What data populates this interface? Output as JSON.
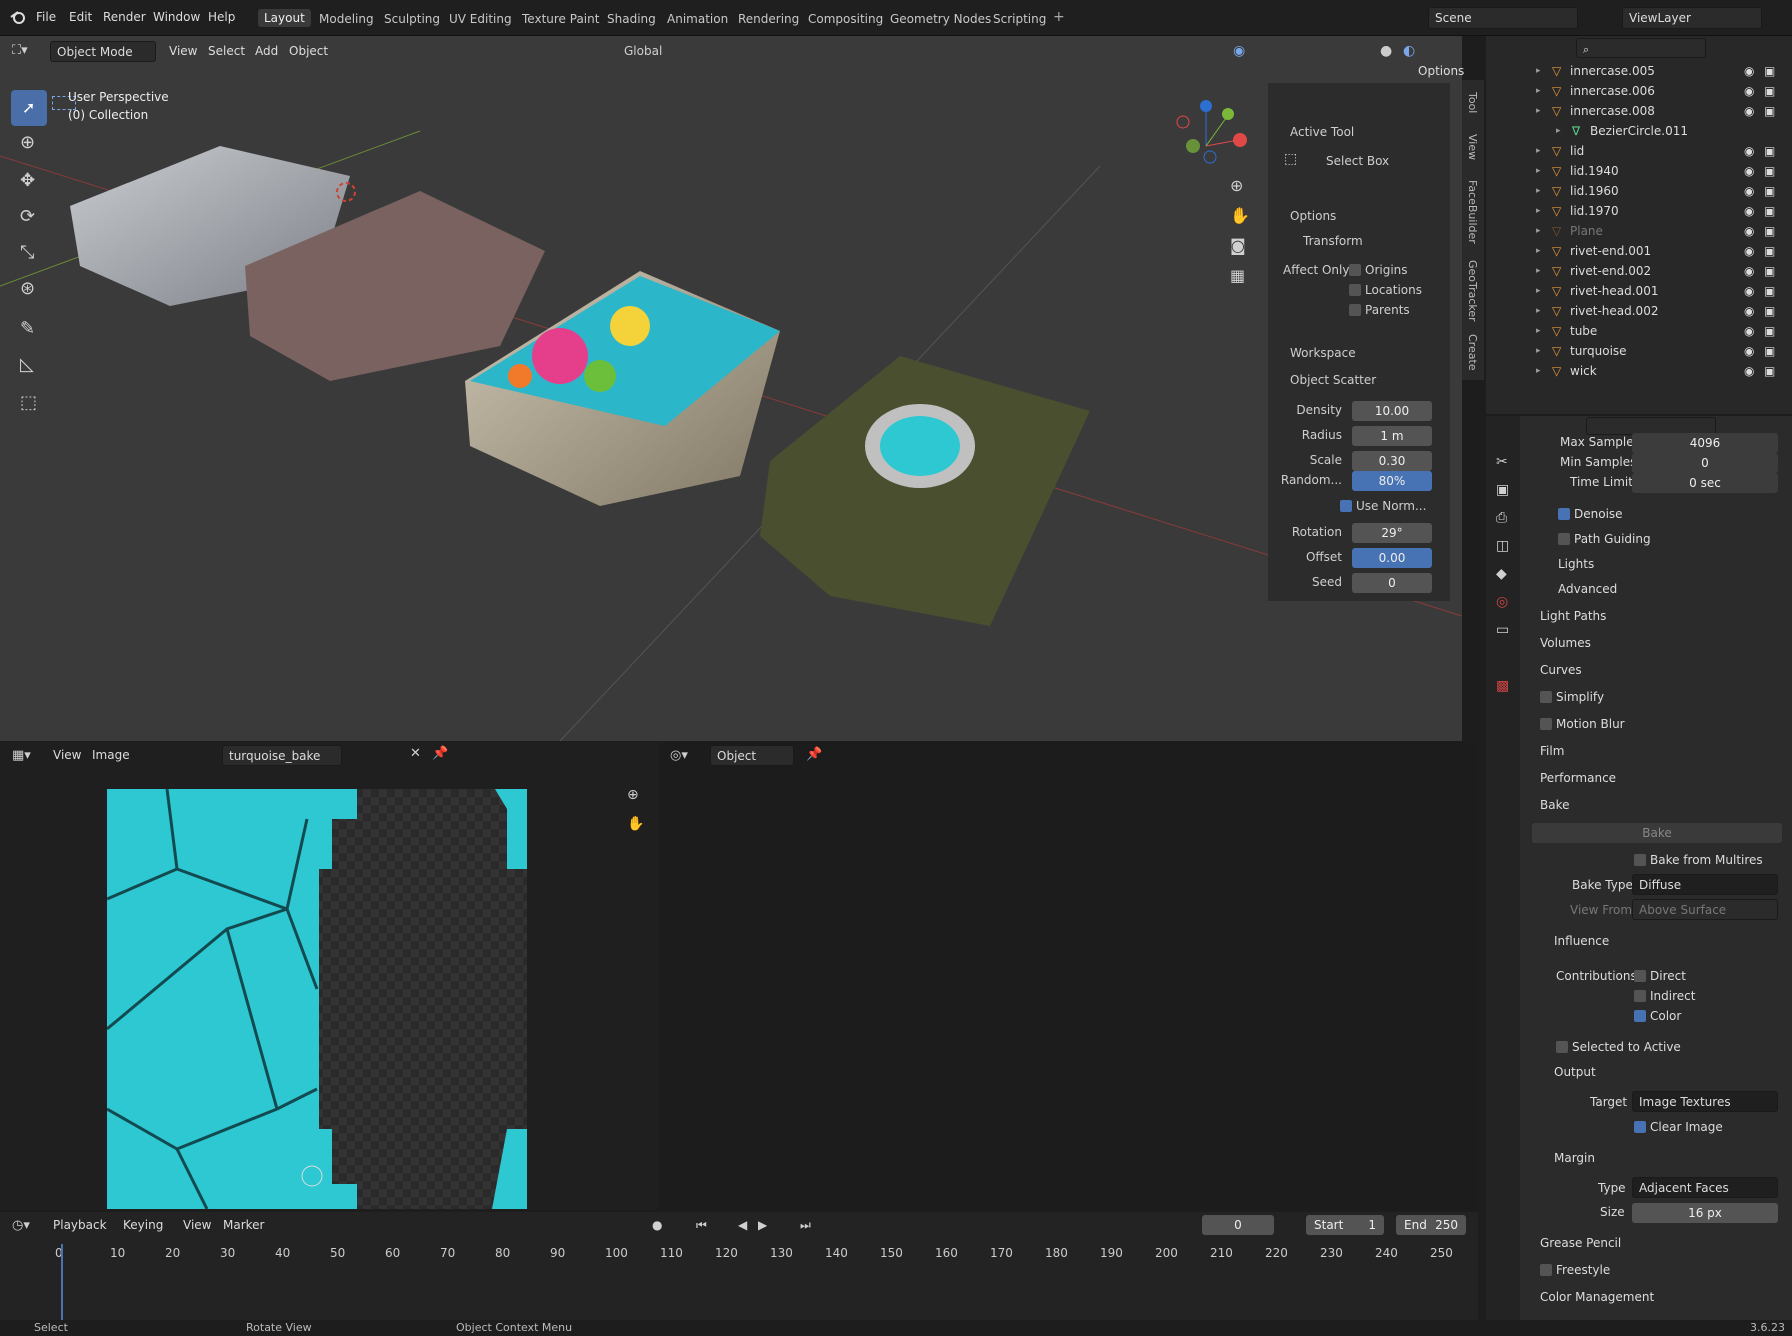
{
  "topbar": {
    "menus": [
      "File",
      "Edit",
      "Render",
      "Window",
      "Help"
    ],
    "workspaces": [
      "Layout",
      "Modeling",
      "Sculpting",
      "UV Editing",
      "Texture Paint",
      "Shading",
      "Animation",
      "Rendering",
      "Compositing",
      "Geometry Nodes",
      "Scripting"
    ],
    "active_workspace": "Layout",
    "scene": "Scene",
    "view_layer": "ViewLayer"
  },
  "viewport": {
    "mode": "Object Mode",
    "menus": [
      "View",
      "Select",
      "Add",
      "Object"
    ],
    "orientation": "Global",
    "options_label": "Options",
    "perspective": "User Perspective",
    "collection": "(0) Collection"
  },
  "npanel": {
    "active_tool_header": "Active Tool",
    "tool_name": "Select Box",
    "options_header": "Options",
    "transform_header": "Transform",
    "affect_only_label": "Affect Only",
    "affect_items": [
      "Origins",
      "Locations",
      "Parents"
    ],
    "workspace_header": "Workspace",
    "scatter_header": "Object Scatter",
    "scatter": [
      {
        "label": "Density",
        "value": "10.00"
      },
      {
        "label": "Radius",
        "value": "1 m"
      },
      {
        "label": "Scale",
        "value": "0.30"
      },
      {
        "label": "Random...",
        "value": "80%"
      }
    ],
    "use_normal": "Use Norm...",
    "scatter2": [
      {
        "label": "Rotation",
        "value": "29°"
      },
      {
        "label": "Offset",
        "value": "0.00"
      },
      {
        "label": "Seed",
        "value": "0"
      }
    ],
    "tabs": [
      "Tool",
      "View",
      "FaceBuilder",
      "GeoTracker",
      "Create"
    ]
  },
  "outliner": {
    "items": [
      {
        "name": "innercase.005",
        "dim": false
      },
      {
        "name": "innercase.006",
        "dim": false
      },
      {
        "name": "innercase.008",
        "dim": false
      },
      {
        "name": "BezierCircle.011",
        "dim": false,
        "child": true
      },
      {
        "name": "lid",
        "dim": false
      },
      {
        "name": "lid.1940",
        "dim": false
      },
      {
        "name": "lid.1960",
        "dim": false
      },
      {
        "name": "lid.1970",
        "dim": false
      },
      {
        "name": "Plane",
        "dim": true
      },
      {
        "name": "rivet-end.001",
        "dim": false
      },
      {
        "name": "rivet-end.002",
        "dim": false
      },
      {
        "name": "rivet-head.001",
        "dim": false
      },
      {
        "name": "rivet-head.002",
        "dim": false
      },
      {
        "name": "tube",
        "dim": false
      },
      {
        "name": "turquoise",
        "dim": false
      },
      {
        "name": "wick",
        "dim": false
      }
    ]
  },
  "properties": {
    "max_samples_label": "Max Samples",
    "max_samples": "4096",
    "min_samples_label": "Min Samples",
    "min_samples": "0",
    "time_limit_label": "Time Limit",
    "time_limit": "0 sec",
    "sub": [
      "Denoise",
      "Path Guiding",
      "Lights",
      "Advanced"
    ],
    "sections": [
      "Light Paths",
      "Volumes",
      "Curves",
      "Simplify",
      "Motion Blur",
      "Film",
      "Performance"
    ],
    "bake_header": "Bake",
    "bake_button": "Bake",
    "bake_multires": "Bake from Multires",
    "bake_type_label": "Bake Type",
    "bake_type": "Diffuse",
    "view_from_label": "View From",
    "view_from": "Above Surface",
    "influence_header": "Influence",
    "contributions_label": "Contributions",
    "contributions": [
      "Direct",
      "Indirect",
      "Color"
    ],
    "selected_to_active": "Selected to Active",
    "output_header": "Output",
    "target_label": "Target",
    "target": "Image Textures",
    "clear_image": "Clear Image",
    "margin_header": "Margin",
    "type_label": "Type",
    "type": "Adjacent Faces",
    "size_label": "Size",
    "size": "16 px",
    "end_sections": [
      "Grease Pencil",
      "Freestyle",
      "Color Management"
    ]
  },
  "image_editor": {
    "menus": [
      "View",
      "Image"
    ],
    "image_name": "turquoise_bake"
  },
  "node_editor": {
    "mode": "Object"
  },
  "timeline": {
    "menus": [
      "Playback",
      "Keying",
      "View",
      "Marker"
    ],
    "current_frame": "0",
    "start_label": "Start",
    "start": "1",
    "end_label": "End",
    "end": "250",
    "ticks": [
      "0",
      "10",
      "20",
      "30",
      "40",
      "50",
      "60",
      "70",
      "80",
      "90",
      "100",
      "110",
      "120",
      "130",
      "140",
      "150",
      "160",
      "170",
      "180",
      "190",
      "200",
      "210",
      "220",
      "230",
      "240",
      "250"
    ]
  },
  "status": {
    "select": "Select",
    "rotate": "Rotate View",
    "context": "Object Context Menu",
    "version": "3.6.23"
  },
  "colors": {
    "accent": "#4772b3",
    "object_icon": "#e89a3c",
    "mesh_icon": "#5bd08a",
    "turquoise": "#2ec8d2"
  }
}
